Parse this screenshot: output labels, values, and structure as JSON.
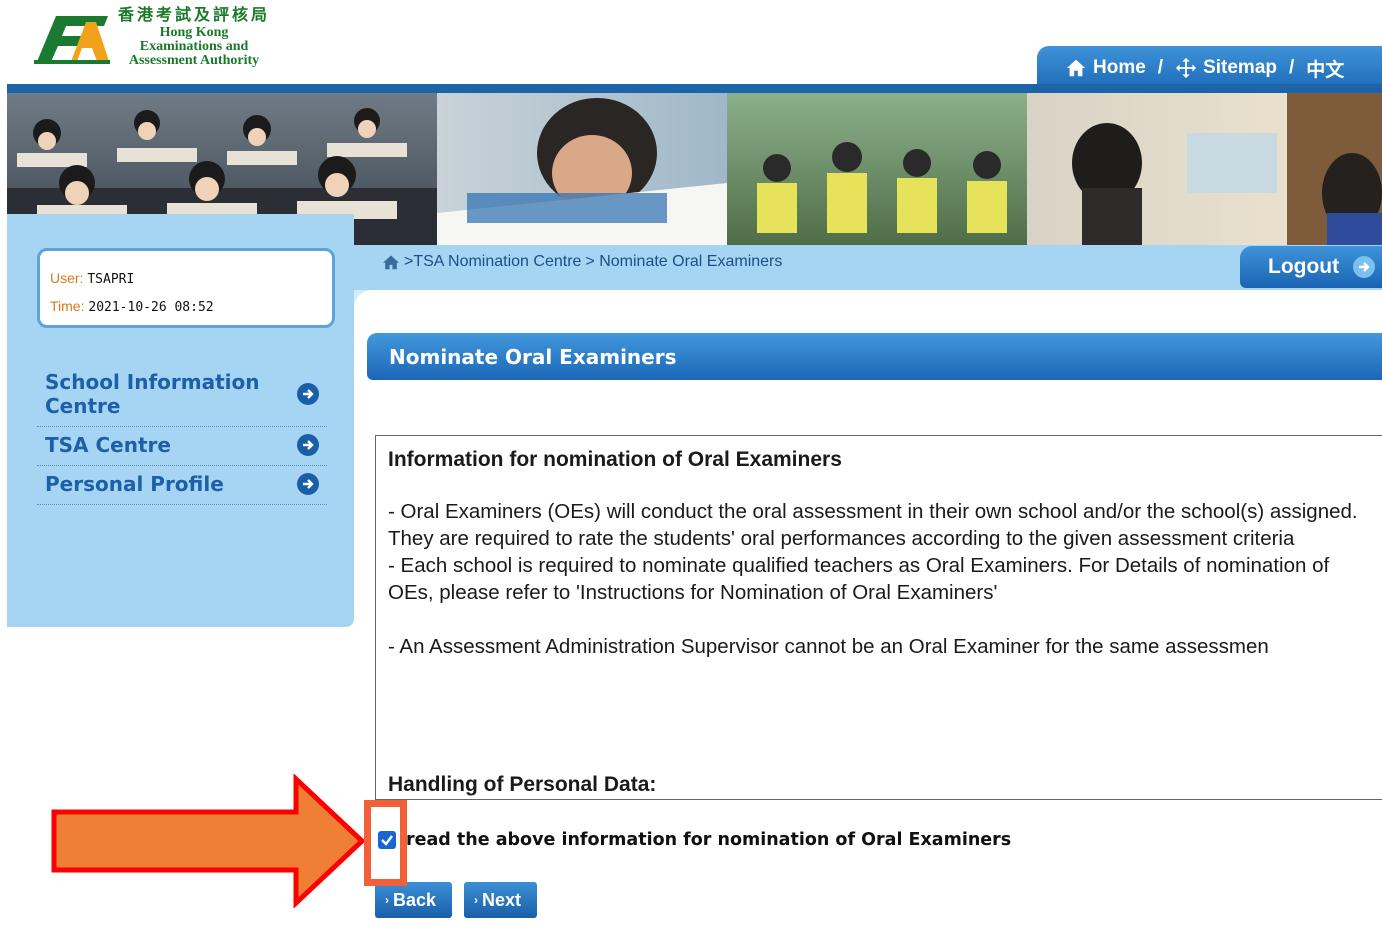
{
  "header": {
    "logo_zh": "香港考試及評核局",
    "logo_en_line1": "Hong Kong",
    "logo_en_line2": "Examinations and",
    "logo_en_line3": "Assessment Authority",
    "nav": {
      "home": "Home",
      "sep1": "/",
      "sitemap": "Sitemap",
      "sep2": "/",
      "chinese": "中文"
    }
  },
  "user_panel": {
    "user_label": "User:",
    "user_value": "TSAPRI",
    "time_label": "Time:",
    "time_value": "2021-10-26 08:52"
  },
  "sidebar": {
    "items": [
      {
        "label_line1": "School Information",
        "label_line2": "Centre"
      },
      {
        "label": "TSA Centre"
      },
      {
        "label": "Personal Profile"
      }
    ]
  },
  "breadcrumb": {
    "part1": ">TSA Nomination Centre",
    "part2": "> Nominate Oral Examiners"
  },
  "logout_label": "Logout",
  "section_title": "Nominate Oral Examiners",
  "info": {
    "heading": "Information for nomination of Oral Examiners",
    "para1": "-   Oral Examiners (OEs) will conduct the oral assessment in their own school and/or the school(s) assigned. They are required to rate the students' oral performances according to the given assessment criteria",
    "para2": "-   Each school is required to nominate qualified teachers as Oral Examiners. For Details of nomination of OEs, please refer to 'Instructions for Nomination of Oral Examiners'",
    "para3": "-   An Assessment Administration Supervisor cannot be an Oral Examiner for the same assessmen",
    "personal_data_heading": "Handling of Personal Data:"
  },
  "agree_text": "read the above information for nomination of Oral Examiners",
  "buttons": {
    "back": "Back",
    "next": "Next"
  },
  "colors": {
    "primary_blue": "#1c6bb8",
    "panel_blue": "#a6d5f3",
    "annotation_orange": "#ef7f35",
    "annotation_red": "#ff0000"
  }
}
